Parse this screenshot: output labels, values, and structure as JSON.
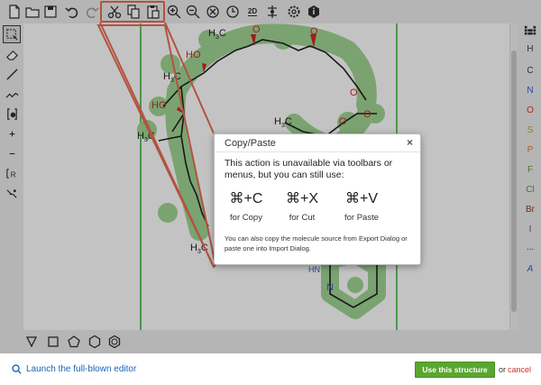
{
  "toolbar": {
    "top_icons": [
      "new-document-icon",
      "open-folder-icon",
      "save-icon",
      "undo-icon",
      "redo-icon",
      "cut-icon",
      "copy-icon",
      "paste-icon",
      "zoom-in-icon",
      "zoom-out-icon",
      "zoom-reset-icon",
      "clean-icon",
      "clean-2d-icon",
      "check-structure-icon",
      "settings-icon",
      "info-icon"
    ],
    "clean_2d_label": "2D",
    "left_icons": [
      "select-icon",
      "eraser-icon",
      "bond-icon",
      "chain-icon",
      "charge-icon",
      "plus-charge-icon",
      "minus-charge-icon",
      "rgroup-icon",
      "reaction-icon"
    ],
    "bottom_icons": [
      "template-cyclopropane-icon",
      "template-cyclobutane-icon",
      "template-cyclopentane-icon",
      "template-cyclohexane-icon",
      "template-benzene-icon"
    ]
  },
  "elements": [
    {
      "symbol": "H",
      "color": "#333333"
    },
    {
      "symbol": "C",
      "color": "#333333"
    },
    {
      "symbol": "N",
      "color": "#2d4fc9"
    },
    {
      "symbol": "O",
      "color": "#d12d2d"
    },
    {
      "symbol": "S",
      "color": "#b5a11a"
    },
    {
      "symbol": "P",
      "color": "#e07d1a"
    },
    {
      "symbol": "F",
      "color": "#5a9a2a"
    },
    {
      "symbol": "Cl",
      "color": "#3e9a2a"
    },
    {
      "symbol": "Br",
      "color": "#8a2a1a"
    },
    {
      "symbol": "I",
      "color": "#8a2ab0"
    },
    {
      "symbol": "...",
      "color": "#333333"
    },
    {
      "symbol": "A",
      "color": "#2d4fc9"
    }
  ],
  "molecule_labels": [
    "HO",
    "H3C",
    "HO",
    "H3C",
    "H3C",
    "H3C",
    "H3C",
    "O",
    "O",
    "O",
    "H3C",
    "O",
    "O",
    "HN",
    "N"
  ],
  "dialog": {
    "title": "Copy/Paste",
    "close": "×",
    "message": "This action is unavailable via toolbars or menus, but you can still use:",
    "shortcuts": [
      {
        "key": "⌘+C",
        "label": "for Copy"
      },
      {
        "key": "⌘+X",
        "label": "for Cut"
      },
      {
        "key": "⌘+V",
        "label": "for Paste"
      }
    ],
    "note": "You can also copy the molecule source from Export Dialog or paste one into Import Dialog."
  },
  "footer": {
    "launch_label": "Launch the full-blown editor",
    "use_label": "Use this structure",
    "or_label": "or",
    "cancel_label": "cancel"
  },
  "colors": {
    "highlight": "#e8644a",
    "atom_highlight": "#9bd38e",
    "guide_line": "#22b022",
    "oxygen": "#d12d2d",
    "use_button": "#5aa62f",
    "link": "#1a63b8",
    "cancel": "#c83232"
  }
}
